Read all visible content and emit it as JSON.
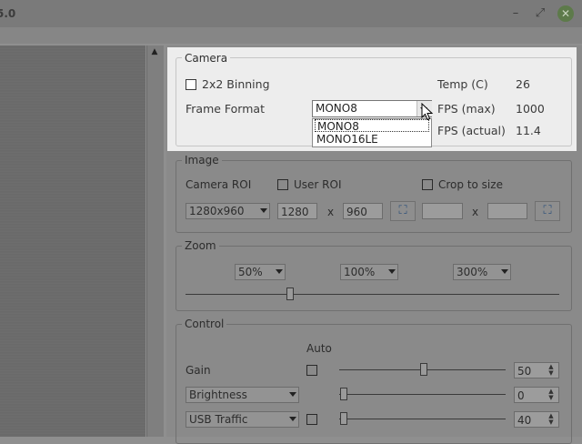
{
  "window": {
    "title_fragment": "5.0",
    "minimize_glyph": "–",
    "restore_glyph": "⤢",
    "close_glyph": "✕"
  },
  "camera": {
    "group_title": "Camera",
    "binning_label": "2x2 Binning",
    "binning_checked": false,
    "frame_format_label": "Frame Format",
    "frame_format_value": "MONO8",
    "frame_format_options": [
      "MONO8",
      "MONO16LE"
    ],
    "temp_label": "Temp (C)",
    "temp_value": "26",
    "fps_max_label": "FPS (max)",
    "fps_max_value": "1000",
    "fps_actual_label": "FPS (actual)",
    "fps_actual_value": "11.4"
  },
  "image": {
    "group_title": "Image",
    "camera_roi_label": "Camera ROI",
    "user_roi_label": "User ROI",
    "crop_label": "Crop to size",
    "roi_select": "1280x960",
    "width_value": "1280",
    "x_label": "x",
    "height_value": "960",
    "crop_width_value": "",
    "crop_x_label": "x",
    "crop_height_value": ""
  },
  "zoom": {
    "group_title": "Zoom",
    "presets": [
      "50%",
      "100%",
      "300%"
    ],
    "slider_fraction": 0.28
  },
  "control": {
    "group_title": "Control",
    "auto_label": "Auto",
    "gain_label": "Gain",
    "gain_value": "50",
    "brightness_select": "Brightness",
    "brightness_value": "0",
    "usb_select": "USB Traffic",
    "usb_value": "40"
  },
  "icons": {
    "fit": "⛶",
    "scroll_up": "▲",
    "spin_up": "▲",
    "spin_down": "▼"
  }
}
